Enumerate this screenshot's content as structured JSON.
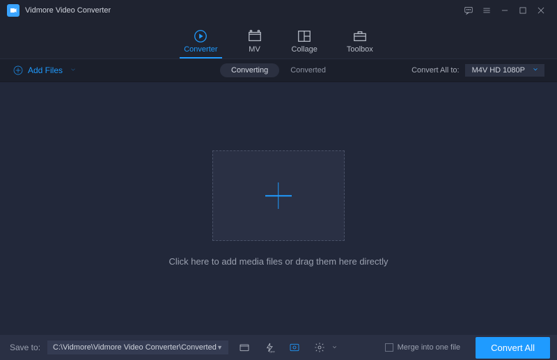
{
  "titlebar": {
    "app_name": "Vidmore Video Converter"
  },
  "topnav": {
    "tabs": [
      {
        "label": "Converter"
      },
      {
        "label": "MV"
      },
      {
        "label": "Collage"
      },
      {
        "label": "Toolbox"
      }
    ]
  },
  "toolbar": {
    "add_files_label": "Add Files",
    "seg_converting": "Converting",
    "seg_converted": "Converted",
    "convert_all_to_label": "Convert All to:",
    "format_selected": "M4V HD 1080P"
  },
  "dropzone": {
    "hint": "Click here to add media files or drag them here directly"
  },
  "bottombar": {
    "save_to_label": "Save to:",
    "save_path": "C:\\Vidmore\\Vidmore Video Converter\\Converted",
    "merge_label": "Merge into one file",
    "convert_all_button": "Convert All"
  }
}
